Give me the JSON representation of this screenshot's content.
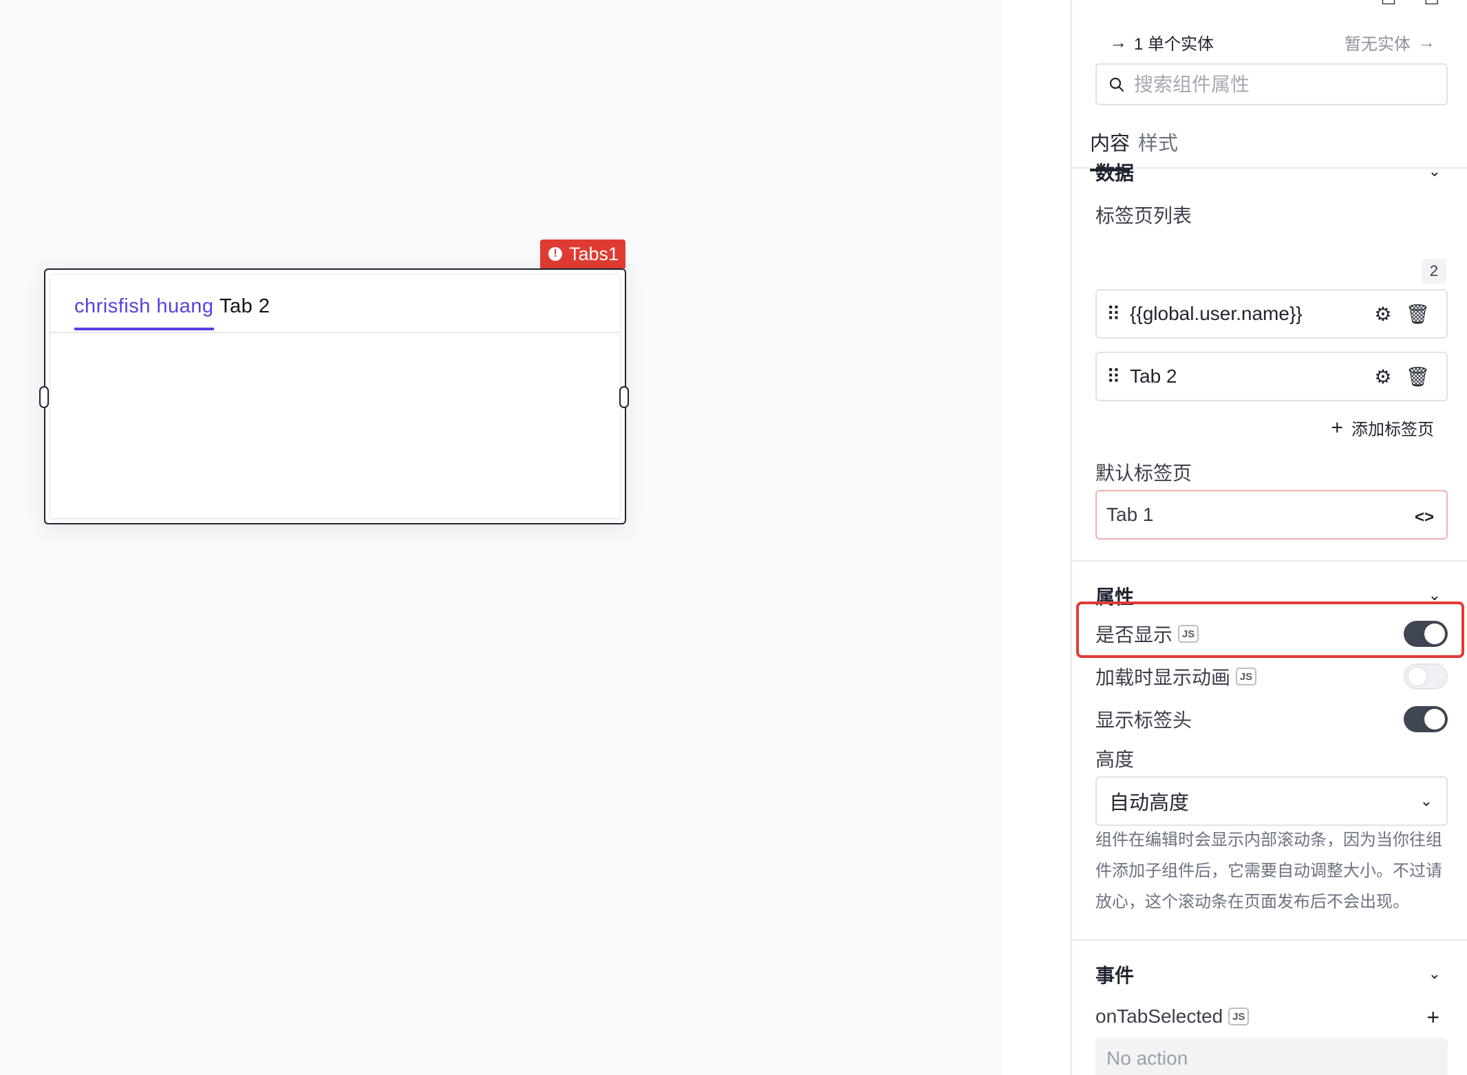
{
  "canvas": {
    "widget_label": "Tabs1",
    "tabs": [
      "chrisfish huang",
      "Tab 2"
    ]
  },
  "panel": {
    "entity": {
      "left_label": "1 单个实体",
      "right_label": "暂无实体"
    },
    "search": {
      "placeholder": "搜索组件属性"
    },
    "tabs": [
      "内容",
      "样式"
    ],
    "data_section": {
      "title": "数据",
      "tab_list_label": "标签页列表",
      "count": "2",
      "items": [
        "{{global.user.name}}",
        "Tab 2"
      ],
      "add_label": "添加标签页",
      "default_tab_label": "默认标签页",
      "default_tab_value": "Tab 1"
    },
    "props_section": {
      "title": "属性",
      "visible_label": "是否显示",
      "animate_label": "加载时显示动画",
      "show_header_label": "显示标签头",
      "js_badge": "JS",
      "visible_on": true,
      "animate_on": false,
      "show_header_on": true,
      "height_label": "高度",
      "height_value": "自动高度",
      "help_lines": [
        "组件在编辑时会显示内部滚动条，因为当你往组",
        "件添加子组件后，它需要自动调整大小。不过请",
        "放心，这个滚动条在页面发布后不会出现。"
      ]
    },
    "events_section": {
      "title": "事件",
      "event_name": "onTabSelected",
      "no_action": "No action"
    }
  },
  "colors": {
    "accent": "#5b3fe0",
    "error": "#e03b32",
    "toggle_on": "#3f4553"
  }
}
